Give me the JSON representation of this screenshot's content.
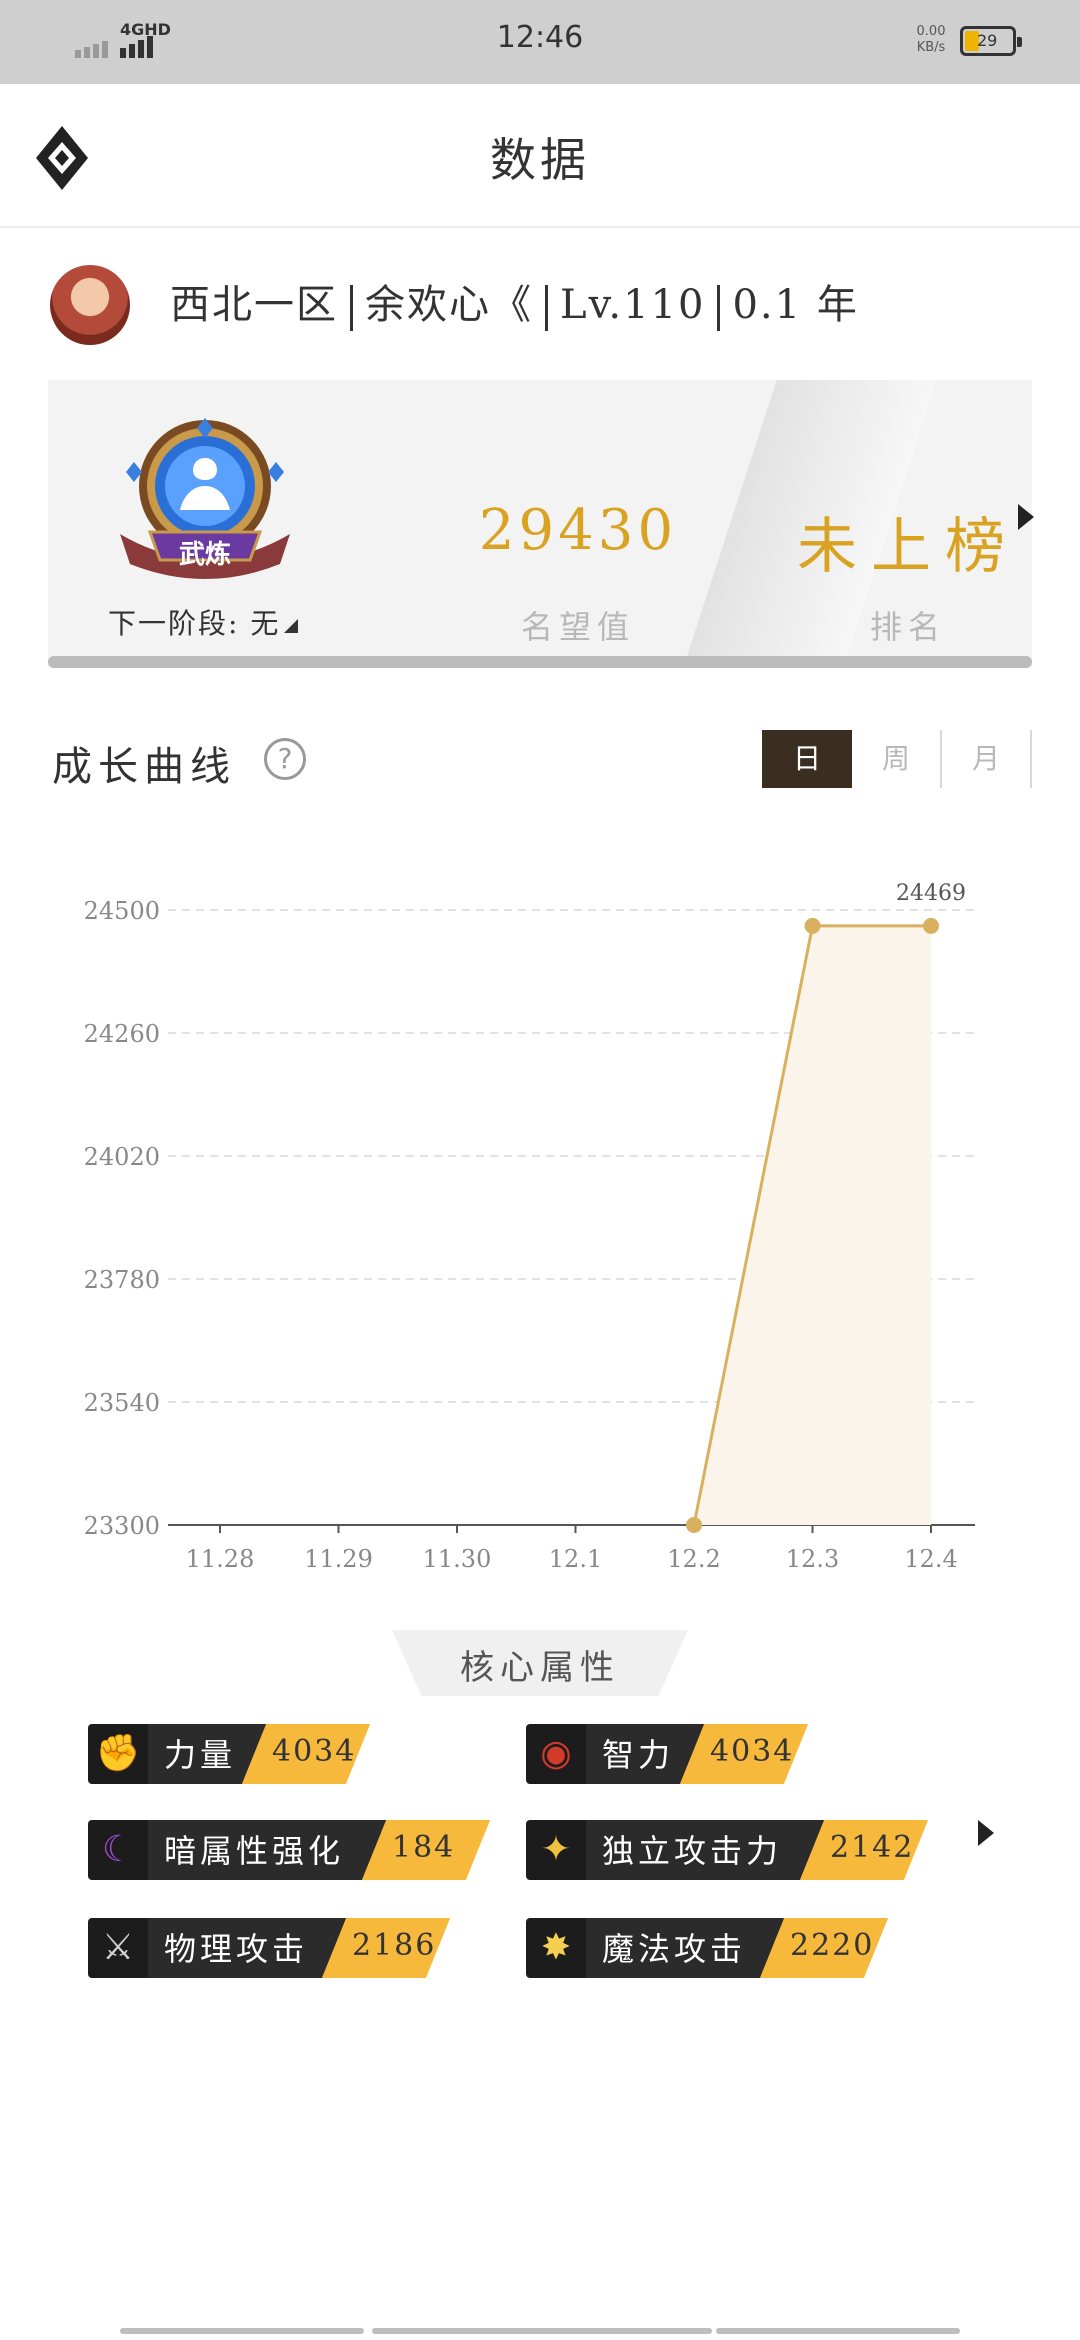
{
  "status_bar": {
    "network": "4GHD",
    "time": "12:46",
    "speed": "0.00",
    "speed_unit": "KB/s",
    "battery": "29"
  },
  "header": {
    "title": "数据"
  },
  "profile": {
    "server": "西北一区",
    "name": "余欢心《",
    "level": "Lv.110",
    "years": "0.1 年"
  },
  "rank_card": {
    "badge_text": "武炼",
    "next_stage": "下一阶段: 无",
    "fame_value": "29430",
    "fame_label": "名望值",
    "rank_value": "未上榜",
    "rank_label": "排名"
  },
  "growth": {
    "title": "成长曲线",
    "help_icon": "question-icon",
    "tabs": [
      "日",
      "周",
      "月"
    ],
    "active_tab": "日"
  },
  "chart_data": {
    "type": "line",
    "categories": [
      "11.28",
      "11.29",
      "11.30",
      "12.1",
      "12.2",
      "12.3",
      "12.4"
    ],
    "y_ticks": [
      "23300",
      "23540",
      "23780",
      "24020",
      "24260",
      "24500"
    ],
    "ylim": [
      23300,
      24500
    ],
    "series": [
      {
        "values": [
          null,
          null,
          null,
          null,
          23300,
          24469,
          24469
        ]
      }
    ],
    "annotations": [
      {
        "category": "12.4",
        "text": "24469"
      }
    ],
    "grid": true,
    "line_color": "#d9b15e"
  },
  "core": {
    "title": "核心属性",
    "attributes": [
      {
        "name": "力量",
        "value": "4034",
        "icon": "fist-icon"
      },
      {
        "name": "智力",
        "value": "4034",
        "icon": "eye-icon"
      },
      {
        "name": "暗属性强化",
        "value": "184",
        "icon": "scythe-icon"
      },
      {
        "name": "独立攻击力",
        "value": "2142",
        "icon": "sword-sparkle-icon"
      },
      {
        "name": "物理攻击",
        "value": "2186",
        "icon": "sword-icon"
      },
      {
        "name": "魔法攻击",
        "value": "2220",
        "icon": "star-burst-icon"
      }
    ]
  }
}
